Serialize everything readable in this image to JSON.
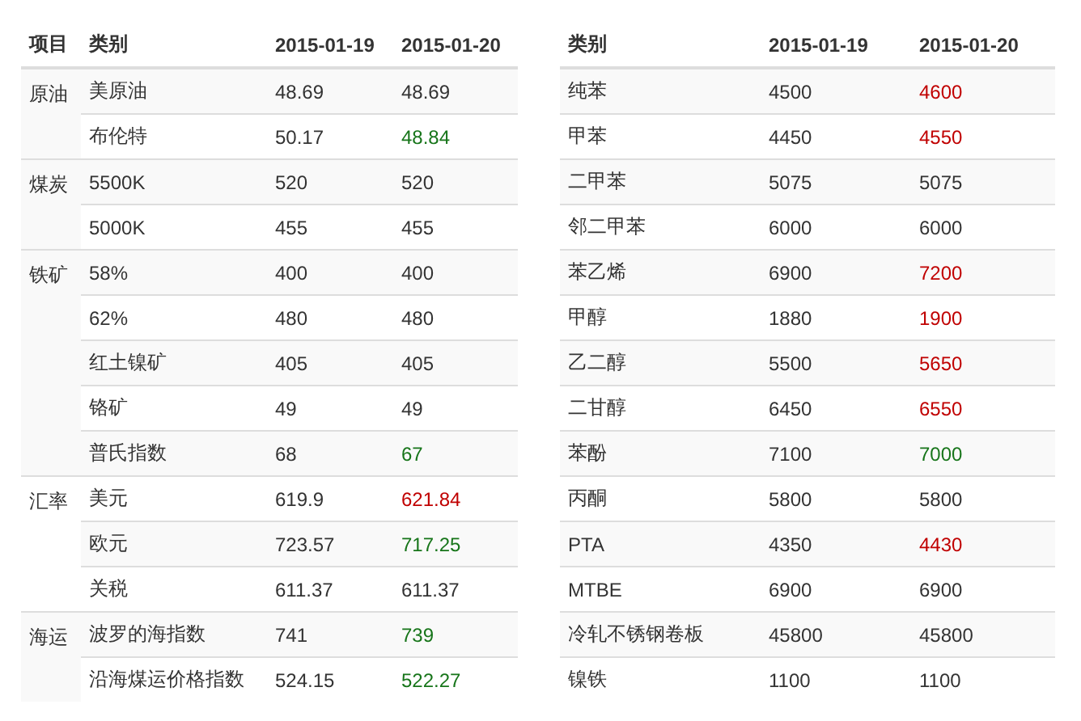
{
  "left_table": {
    "columns": [
      "项目",
      "类别",
      "2015-01-19",
      "2015-01-20"
    ],
    "groups": [
      {
        "name": "原油",
        "rows": [
          {
            "category": "美原油",
            "prev": "48.69",
            "curr": "48.69",
            "color": "#333333"
          },
          {
            "category": "布伦特",
            "prev": "50.17",
            "curr": "48.84",
            "color": "#17751a"
          }
        ]
      },
      {
        "name": "煤炭",
        "rows": [
          {
            "category": "5500K",
            "prev": "520",
            "curr": "520",
            "color": "#333333"
          },
          {
            "category": "5000K",
            "prev": "455",
            "curr": "455",
            "color": "#333333"
          }
        ]
      },
      {
        "name": "铁矿",
        "rows": [
          {
            "category": "58%",
            "prev": "400",
            "curr": "400",
            "color": "#333333"
          },
          {
            "category": "62%",
            "prev": "480",
            "curr": "480",
            "color": "#333333"
          },
          {
            "category": "红土镍矿",
            "prev": "405",
            "curr": "405",
            "color": "#333333"
          },
          {
            "category": "铬矿",
            "prev": "49",
            "curr": "49",
            "color": "#333333"
          },
          {
            "category": "普氏指数",
            "prev": "68",
            "curr": "67",
            "color": "#17751a"
          }
        ]
      },
      {
        "name": "汇率",
        "rows": [
          {
            "category": "美元",
            "prev": "619.9",
            "curr": "621.84",
            "color": "#c00000"
          },
          {
            "category": "欧元",
            "prev": "723.57",
            "curr": "717.25",
            "color": "#17751a"
          },
          {
            "category": "关税",
            "prev": "611.37",
            "curr": "611.37",
            "color": "#333333"
          }
        ]
      },
      {
        "name": "海运",
        "rows": [
          {
            "category": "波罗的海指数",
            "prev": "741",
            "curr": "739",
            "color": "#17751a"
          },
          {
            "category": "沿海煤运价格指数",
            "prev": "524.15",
            "curr": "522.27",
            "color": "#17751a"
          }
        ]
      }
    ]
  },
  "right_table": {
    "columns": [
      "类别",
      "2015-01-19",
      "2015-01-20"
    ],
    "rows": [
      {
        "category": "纯苯",
        "prev": "4500",
        "curr": "4600",
        "color": "#c00000"
      },
      {
        "category": "甲苯",
        "prev": "4450",
        "curr": "4550",
        "color": "#c00000"
      },
      {
        "category": "二甲苯",
        "prev": "5075",
        "curr": "5075",
        "color": "#333333"
      },
      {
        "category": "邻二甲苯",
        "prev": "6000",
        "curr": "6000",
        "color": "#333333"
      },
      {
        "category": "苯乙烯",
        "prev": "6900",
        "curr": "7200",
        "color": "#c00000"
      },
      {
        "category": "甲醇",
        "prev": "1880",
        "curr": "1900",
        "color": "#c00000"
      },
      {
        "category": "乙二醇",
        "prev": "5500",
        "curr": "5650",
        "color": "#c00000"
      },
      {
        "category": "二甘醇",
        "prev": "6450",
        "curr": "6550",
        "color": "#c00000"
      },
      {
        "category": "苯酚",
        "prev": "7100",
        "curr": "7000",
        "color": "#17751a"
      },
      {
        "category": "丙酮",
        "prev": "5800",
        "curr": "5800",
        "color": "#333333"
      },
      {
        "category": "PTA",
        "prev": "4350",
        "curr": "4430",
        "color": "#c00000"
      },
      {
        "category": "MTBE",
        "prev": "6900",
        "curr": "6900",
        "color": "#333333"
      },
      {
        "category": "冷轧不锈钢卷板",
        "prev": "45800",
        "curr": "45800",
        "color": "#333333"
      },
      {
        "category": "镍铁",
        "prev": "1100",
        "curr": "1100",
        "color": "#333333"
      }
    ]
  }
}
